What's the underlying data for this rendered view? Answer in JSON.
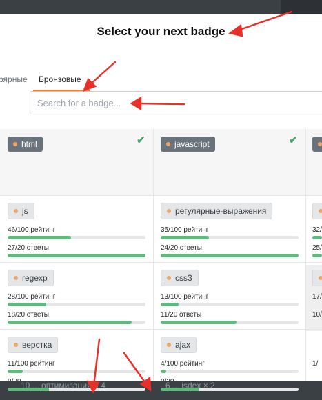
{
  "modal": {
    "title": "Select your next badge"
  },
  "tabs": {
    "partial_label": "рярные",
    "active_label": "Бронзовые"
  },
  "search": {
    "placeholder": "Search for a badge..."
  },
  "columns": [
    {
      "tag": "html",
      "completed": true
    },
    {
      "tag": "javascript",
      "completed": true
    }
  ],
  "cards": {
    "r1c1": {
      "tag": "js",
      "score_label": "46/100 рейтинг",
      "score": 0.46,
      "answers_label": "27/20 ответы",
      "answers": 1.0
    },
    "r1c2": {
      "tag": "регулярные-выражения",
      "score_label": "35/100 рейтинг",
      "score": 0.35,
      "answers_label": "24/20 ответы",
      "answers": 1.0
    },
    "r1c3": {
      "score_label": "32/",
      "answers_label": "25/"
    },
    "r2c1": {
      "tag": "regexp",
      "score_label": "28/100 рейтинг",
      "score": 0.28,
      "answers_label": "18/20 ответы",
      "answers": 0.9
    },
    "r2c2": {
      "tag": "css3",
      "score_label": "13/100 рейтинг",
      "score": 0.13,
      "answers_label": "11/20 ответы",
      "answers": 0.55
    },
    "r2c3": {
      "score_label": "17/",
      "answers_label": "10/"
    },
    "r3c1": {
      "tag": "верстка",
      "score_label": "11/100 рейтинг",
      "score": 0.11,
      "answers_label": "9/20"
    },
    "r3c2": {
      "tag": "ajax",
      "score_label": "4/100 рейтинг",
      "score": 0.04,
      "answers_label": "0/20"
    },
    "r3c3": {
      "score_label": "1/"
    }
  },
  "bottom_bar": {
    "left_label": "10 ... оптимизация × 4",
    "right_label": "6 ... jsdex × 2"
  },
  "colors": {
    "accent": "#f48024",
    "progress": "#5fba7d",
    "check": "#48a868",
    "tag_dark": "#6a737c",
    "annotation_arrow": "#e8302a"
  },
  "icons": {
    "check": "check-icon"
  }
}
